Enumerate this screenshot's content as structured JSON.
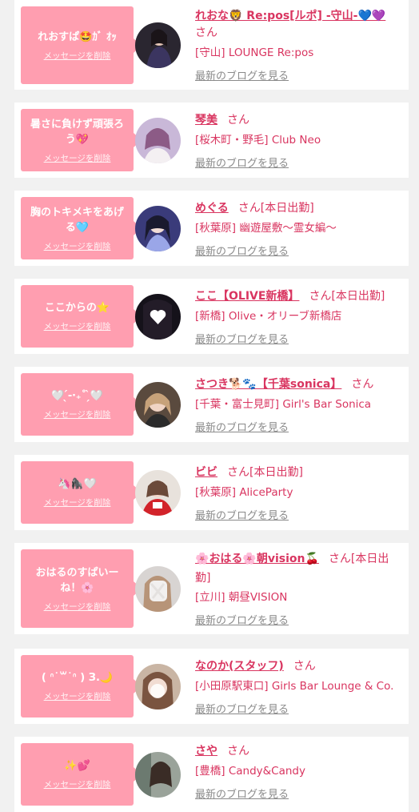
{
  "delete_label": "メッセージを削除",
  "blog_label": "最新のブログを見る",
  "san_label": "さん",
  "accent_color": "#d93560",
  "bubble_color": "#ff9eb0",
  "cards": [
    {
      "message": "れおすぱ🤩ｶﾞ ｵｯ",
      "name": "れおな🦁 Re:pos[ルポ] -守山-💙💜",
      "suffix": "さん",
      "shop": "[守山] LOUNGE Re:pos",
      "avatar_icon": "avatar-photo"
    },
    {
      "message": "暑さに負けず頑張ろう💖",
      "name": "琴美",
      "suffix": "さん",
      "shop": "[桜木町・野毛] Club Neo",
      "avatar_icon": "avatar-photo"
    },
    {
      "message": "胸のトキメキをあげる🩵",
      "name": "めぐる",
      "suffix": "さん[本日出勤]",
      "shop": "[秋葉原] 幽遊屋敷～霊女編～",
      "avatar_icon": "avatar-photo"
    },
    {
      "message": "ここからの⭐",
      "name": "ここ【OLIVE新橋】",
      "suffix": "さん[本日出勤]",
      "shop": "[新橋] Olive・オリーブ新橋店",
      "avatar_icon": "avatar-photo"
    },
    {
      "message": "🤍 ̖́-‧₊˚ ̗̀🤍",
      "name": "さつき🐕🐾【千葉sonica】",
      "suffix": "さん",
      "shop": "[千葉・富士見町] Girl's Bar Sonica",
      "avatar_icon": "avatar-photo"
    },
    {
      "message": "🦄🦍🤍",
      "name": "ビビ",
      "suffix": "さん[本日出勤]",
      "shop": "[秋葉原] AliceParty",
      "avatar_icon": "avatar-photo"
    },
    {
      "message": "おはるのすぱいーね！🌸",
      "name": "🌸おはる🌸朝vision🍒",
      "suffix": "さん[本日出勤]",
      "shop": "[立川] 朝昼VISION",
      "avatar_icon": "avatar-photo"
    },
    {
      "message": "( ᐢ˙꒳˙ᐢ ) З.🌙",
      "name": "なのか(スタッフ)",
      "suffix": "さん",
      "shop": "[小田原駅東口] Girls Bar Lounge & Co.",
      "avatar_icon": "avatar-photo"
    },
    {
      "message": "✨💕",
      "name": "さや",
      "suffix": "さん",
      "shop": "[豊橋] Candy&Candy",
      "avatar_icon": "avatar-photo"
    }
  ]
}
